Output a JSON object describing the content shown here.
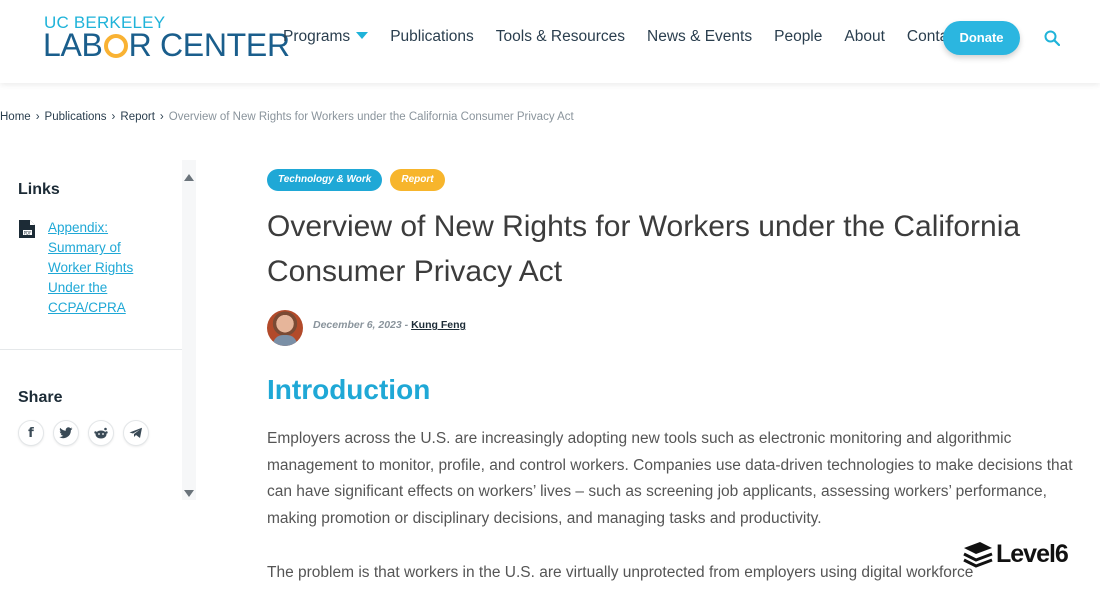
{
  "header": {
    "logo_top": "UC BERKELEY",
    "logo_bottom_1": "LAB",
    "logo_bottom_2": "R CENTER",
    "nav": [
      "Programs",
      "Publications",
      "Tools & Resources",
      "News & Events",
      "People",
      "About",
      "Contact"
    ],
    "donate_label": "Donate",
    "accent_color": "#1fb3d9",
    "brand_color": "#1a5e8c"
  },
  "breadcrumb": {
    "items": [
      "Home",
      "Publications",
      "Report"
    ],
    "current": "Overview of New Rights for Workers under the California Consumer Privacy Act"
  },
  "sidebar": {
    "links_heading": "Links",
    "link_text": "Appendix: Summary of Worker Rights Under the CCPA/CPRA",
    "share_heading": "Share",
    "share_icons": [
      "facebook-icon",
      "twitter-icon",
      "reddit-icon",
      "telegram-icon"
    ]
  },
  "article": {
    "tags": [
      "Technology & Work",
      "Report"
    ],
    "title": "Overview of New Rights for Workers under the California Consumer Privacy Act",
    "date": "December 6, 2023",
    "byline_sep": " - ",
    "author": "Kung Feng",
    "intro_heading": "Introduction",
    "para1": "Employers across the U.S. are increasingly adopting new tools such as electronic monitoring and algorithmic management to monitor, profile, and control workers. Companies use data-driven technologies to make decisions that can have significant effects on workers’ lives – such as screening job applicants, assessing workers’ performance, making promotion or disciplinary decisions, and managing tasks and productivity.",
    "para2": "The problem is that workers in the U.S. are virtually unprotected from employers using digital workforce"
  },
  "watermark": {
    "text": "Level6"
  }
}
